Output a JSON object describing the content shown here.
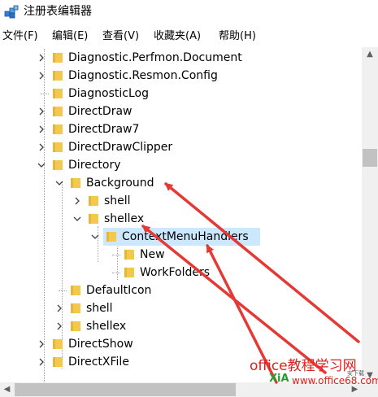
{
  "window": {
    "title": "注册表编辑器"
  },
  "menu": [
    "文件(F)",
    "编辑(E)",
    "查看(V)",
    "收藏夹(A)",
    "帮助(H)"
  ],
  "tree": [
    {
      "label": "Diagnostic.Perfmon.Document",
      "expander": "collapsed",
      "selected": false
    },
    {
      "label": "Diagnostic.Resmon.Config",
      "expander": "collapsed",
      "selected": false
    },
    {
      "label": "DiagnosticLog",
      "expander": "none",
      "selected": false
    },
    {
      "label": "DirectDraw",
      "expander": "collapsed",
      "selected": false
    },
    {
      "label": "DirectDraw7",
      "expander": "collapsed",
      "selected": false
    },
    {
      "label": "DirectDrawClipper",
      "expander": "collapsed",
      "selected": false
    },
    {
      "label": "Directory",
      "expander": "expanded",
      "selected": false
    },
    {
      "label": "Background",
      "expander": "expanded",
      "selected": false
    },
    {
      "label": "shell",
      "expander": "collapsed",
      "selected": false
    },
    {
      "label": "shellex",
      "expander": "expanded",
      "selected": false
    },
    {
      "label": "ContextMenuHandlers",
      "expander": "expanded",
      "selected": true
    },
    {
      "label": "New",
      "expander": "none",
      "selected": false
    },
    {
      "label": "WorkFolders",
      "expander": "none",
      "selected": false
    },
    {
      "label": "DefaultIcon",
      "expander": "none",
      "selected": false
    },
    {
      "label": "shell",
      "expander": "collapsed",
      "selected": false
    },
    {
      "label": "shellex",
      "expander": "collapsed",
      "selected": false
    },
    {
      "label": "DirectShow",
      "expander": "collapsed",
      "selected": false
    },
    {
      "label": "DirectXFile",
      "expander": "collapsed",
      "selected": false
    }
  ],
  "watermark": {
    "main": "office教程学习网",
    "url": "www.office68.com",
    "xia": "XiA",
    "small": "安下载"
  },
  "colors": {
    "selection": "#cce8ff",
    "folder": "#f2c94c",
    "annotation_arrow": "#e53935",
    "watermark": "#e0201c"
  },
  "icons": {
    "app": "registry-editor-icon",
    "folder": "folder-icon",
    "expand": "chevron-right-icon",
    "collapse": "chevron-down-icon"
  }
}
